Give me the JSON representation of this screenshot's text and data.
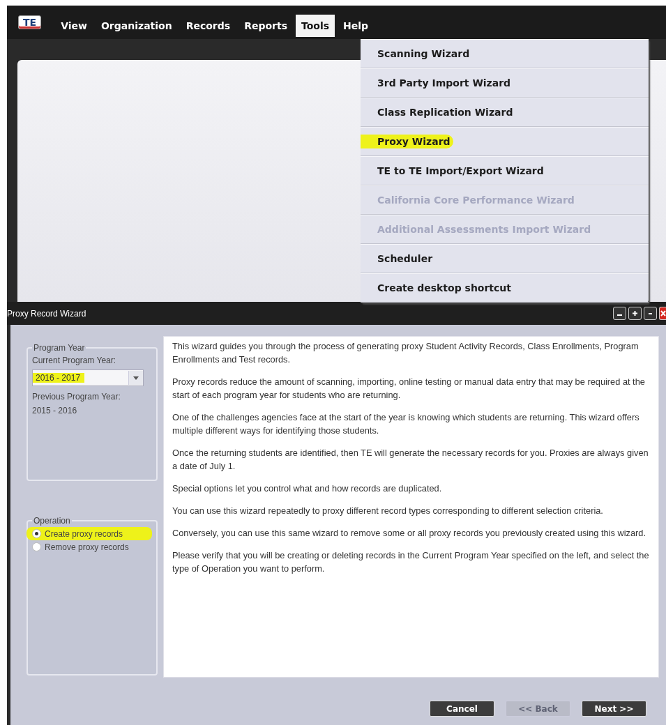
{
  "menu_bar": {
    "logo": "TE",
    "items": [
      {
        "label": "View",
        "selected": false
      },
      {
        "label": "Organization",
        "selected": false
      },
      {
        "label": "Records",
        "selected": false
      },
      {
        "label": "Reports",
        "selected": false
      },
      {
        "label": "Tools",
        "selected": true
      },
      {
        "label": "Help",
        "selected": false
      }
    ]
  },
  "tools_menu": {
    "items": [
      {
        "label": "Scanning Wizard",
        "disabled": false,
        "highlighted": false
      },
      {
        "label": "3rd Party Import Wizard",
        "disabled": false,
        "highlighted": false
      },
      {
        "label": "Class Replication Wizard",
        "disabled": false,
        "highlighted": false
      },
      {
        "label": "Proxy Wizard",
        "disabled": false,
        "highlighted": true
      },
      {
        "label": "TE to TE Import/Export Wizard",
        "disabled": false,
        "highlighted": false
      },
      {
        "label": "California Core Performance Wizard",
        "disabled": true,
        "highlighted": false
      },
      {
        "label": "Additional Assessments Import Wizard",
        "disabled": true,
        "highlighted": false
      },
      {
        "label": "Scheduler",
        "disabled": false,
        "highlighted": false
      },
      {
        "label": "Create desktop shortcut",
        "disabled": false,
        "highlighted": false
      }
    ]
  },
  "dialog": {
    "title": "Proxy Record Wizard",
    "program_year": {
      "legend": "Program Year",
      "current_label": "Current Program Year:",
      "current_value": "2016 - 2017",
      "current_highlighted": true,
      "previous_label": "Previous Program Year:",
      "previous_value": "2015 - 2016"
    },
    "operation": {
      "legend": "Operation",
      "options": [
        {
          "label": "Create proxy records",
          "selected": true,
          "highlighted": true
        },
        {
          "label": "Remove proxy records",
          "selected": false,
          "highlighted": false
        }
      ]
    },
    "description": [
      "This wizard guides you through the process of generating proxy Student Activity Records, Class Enrollments, Program Enrollments and Test records.",
      "Proxy records reduce the amount of scanning, importing, online testing or manual data entry that may be required at the start of each program year for students who are returning.",
      "One of the challenges agencies face at the start of the year is knowing which students are returning. This wizard offers multiple different ways for identifying those students.",
      "Once the returning students are identified, then TE will generate the necessary records for you. Proxies are always given a date of July 1.",
      "Special options let you control what and how records are duplicated.",
      "You can use this wizard repeatedly to proxy different record types corresponding to different selection criteria.",
      "Conversely, you can use this same wizard to remove some or all proxy records you previously created using this wizard.",
      "Please verify that you will be creating or deleting records in the Current Program Year specified on the left, and select the type of Operation you want to perform."
    ],
    "buttons": [
      {
        "label": "Cancel",
        "disabled": false
      },
      {
        "label": "<< Back",
        "disabled": true
      },
      {
        "label": "Next >>",
        "disabled": false
      }
    ]
  }
}
